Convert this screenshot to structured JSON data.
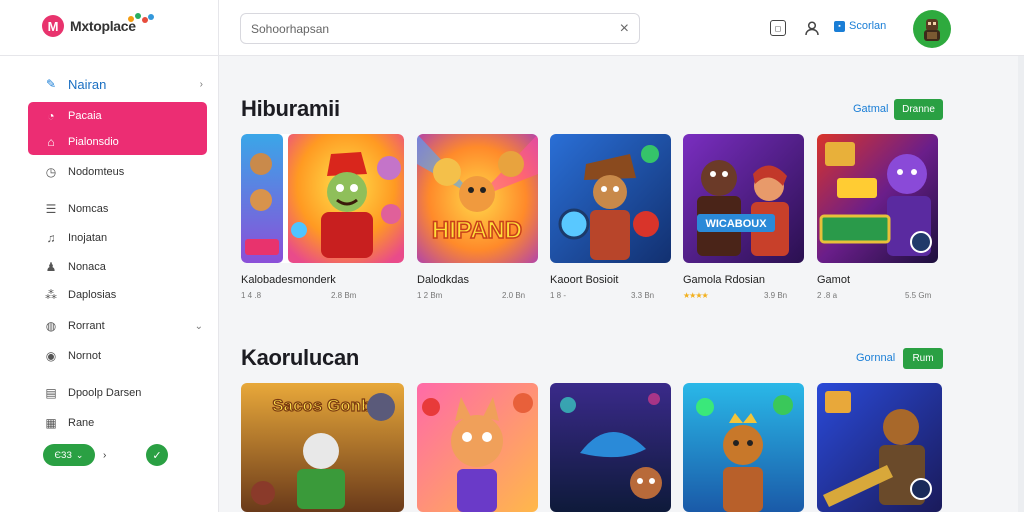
{
  "app": {
    "logo_letter": "M",
    "logo_text": "Mxtoplace"
  },
  "header": {
    "search_placeholder": "Sohoorhapsan",
    "clear_icon": "close-icon",
    "box_icon_text": "◻",
    "signin_label": "Scorlan",
    "signin_icon_text": "▪"
  },
  "sidebar": {
    "items": [
      {
        "label": "Nairan",
        "icon": "pencil-icon",
        "glyph": "✎"
      },
      {
        "label": "Pacaia",
        "icon": "circle-icon",
        "glyph": "◔"
      },
      {
        "label": "Pialonsdio",
        "icon": "bag-icon",
        "glyph": "⌂"
      },
      {
        "label": "Nodomteus",
        "icon": "clock-icon",
        "glyph": "◷"
      },
      {
        "label": "Nomcas",
        "icon": "list-icon",
        "glyph": "☰"
      },
      {
        "label": "Inojatan",
        "icon": "bell-icon",
        "glyph": "♫"
      },
      {
        "label": "Nonaca",
        "icon": "person-icon",
        "glyph": "♟"
      },
      {
        "label": "Daplosias",
        "icon": "share-icon",
        "glyph": "⁂"
      },
      {
        "label": "Rorrant",
        "icon": "globe-icon",
        "glyph": "◍"
      },
      {
        "label": "Nornot",
        "icon": "compass-icon",
        "glyph": "◉"
      },
      {
        "label": "Dpoolp Darsen",
        "icon": "doc-icon",
        "glyph": "▤"
      },
      {
        "label": "Rane",
        "icon": "grid-icon",
        "glyph": "▦"
      }
    ],
    "pill_label": "ЄЗЗ",
    "pill_caret": "⌄",
    "after_pill": "›",
    "check_glyph": "✓"
  },
  "sections": [
    {
      "title": "Hiburamii",
      "link": "Gatmal",
      "button": "Dranne",
      "cards": [
        {
          "title": "Kalobadesmonderk",
          "meta_left": "1 4 .8",
          "meta_right": "2.8 Bm",
          "rating": ""
        },
        {
          "title": "Dalodkdas",
          "meta_left": "1 2 Bm",
          "meta_right": "2.0 Bn",
          "rating": "",
          "art_text": "HIPAND"
        },
        {
          "title": "Kaoort Bosioit",
          "meta_left": "1 8 -",
          "meta_right": "3.3 Bn",
          "rating": ""
        },
        {
          "title": "Gamola Rdosian",
          "meta_left": "",
          "meta_right": "3.9 Bn",
          "rating": "★★★★",
          "art_text": "WICABOUX"
        },
        {
          "title": "Gamot",
          "meta_left": "2 .8 a",
          "meta_right": "5.5 Gm",
          "rating": ""
        }
      ]
    },
    {
      "title": "Kaorulucan",
      "link": "Gornnal",
      "button": "Rum",
      "cards": [
        {
          "title": "",
          "art_text": "Sacos Gonbo"
        },
        {
          "title": ""
        },
        {
          "title": ""
        },
        {
          "title": ""
        },
        {
          "title": ""
        }
      ]
    }
  ],
  "colors": {
    "accent_pink": "#ec2d73",
    "accent_green": "#2aa043",
    "link_blue": "#1a7ed6"
  }
}
